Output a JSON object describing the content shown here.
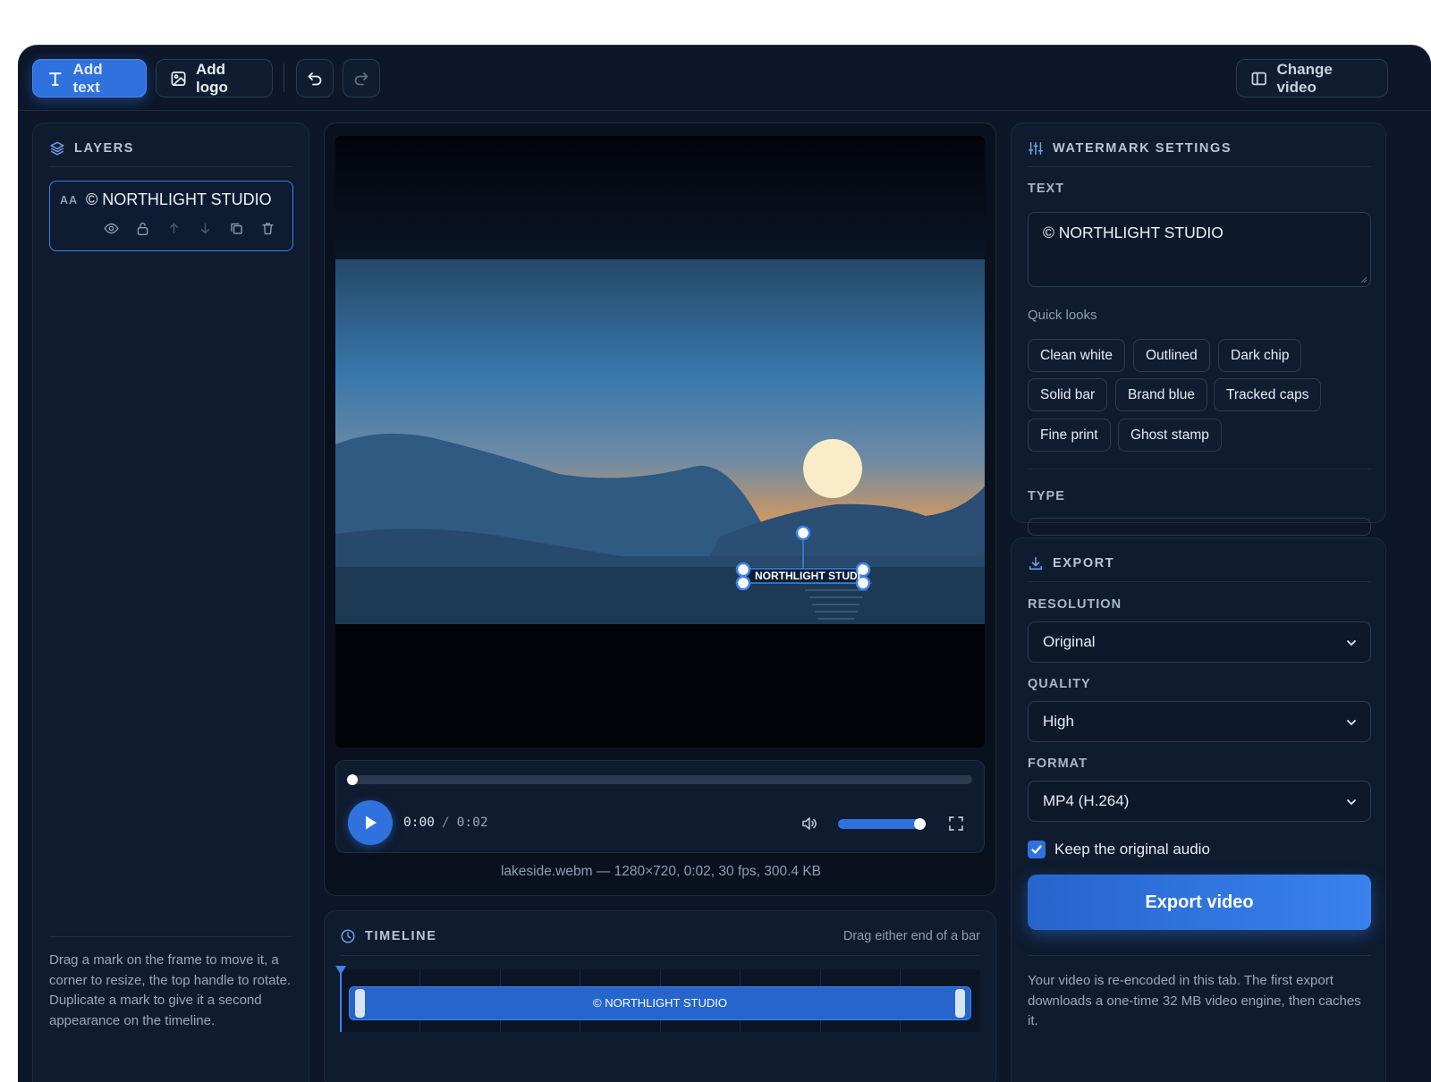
{
  "toolbar": {
    "add_text": "Add text",
    "add_logo": "Add logo",
    "change_video": "Change video"
  },
  "layers": {
    "title": "LAYERS",
    "item": {
      "type_badge": "AA",
      "name": "© NORTHLIGHT STUDIO"
    },
    "help": "Drag a mark on the frame to move it, a corner to resize, the top handle to rotate. Duplicate a mark to give it a second appearance on the timeline."
  },
  "preview": {
    "overlay_text": "NORTHLIGHT STUDI",
    "player": {
      "current": "0:00",
      "separator": "/",
      "duration": "0:02",
      "progress": 0,
      "volume": 1.0
    },
    "file_info": "lakeside.webm — 1280×720, 0:02, 30 fps, 300.4 KB"
  },
  "timeline": {
    "title": "TIMELINE",
    "hint": "Drag either end of a bar",
    "bar_label": "© NORTHLIGHT STUDIO"
  },
  "settings": {
    "title": "WATERMARK SETTINGS",
    "text_label": "TEXT",
    "text_value": "© NORTHLIGHT STUDIO",
    "quick_looks_label": "Quick looks",
    "quick_looks": [
      "Clean white",
      "Outlined",
      "Dark chip",
      "Solid bar",
      "Brand blue",
      "Tracked caps",
      "Fine print",
      "Ghost stamp"
    ],
    "type_label": "TYPE"
  },
  "export": {
    "title": "EXPORT",
    "resolution_label": "RESOLUTION",
    "resolution": "Original",
    "quality_label": "QUALITY",
    "quality": "High",
    "format_label": "FORMAT",
    "format": "MP4 (H.264)",
    "keep_audio_label": "Keep the original audio",
    "keep_audio": true,
    "button": "Export video",
    "note": "Your video is re-encoded in this tab. The first export downloads a one-time 32 MB video engine, then caches it."
  },
  "colors": {
    "accent": "#2f72dd",
    "background": "#0d1729",
    "panel": "#0f1b2e"
  }
}
